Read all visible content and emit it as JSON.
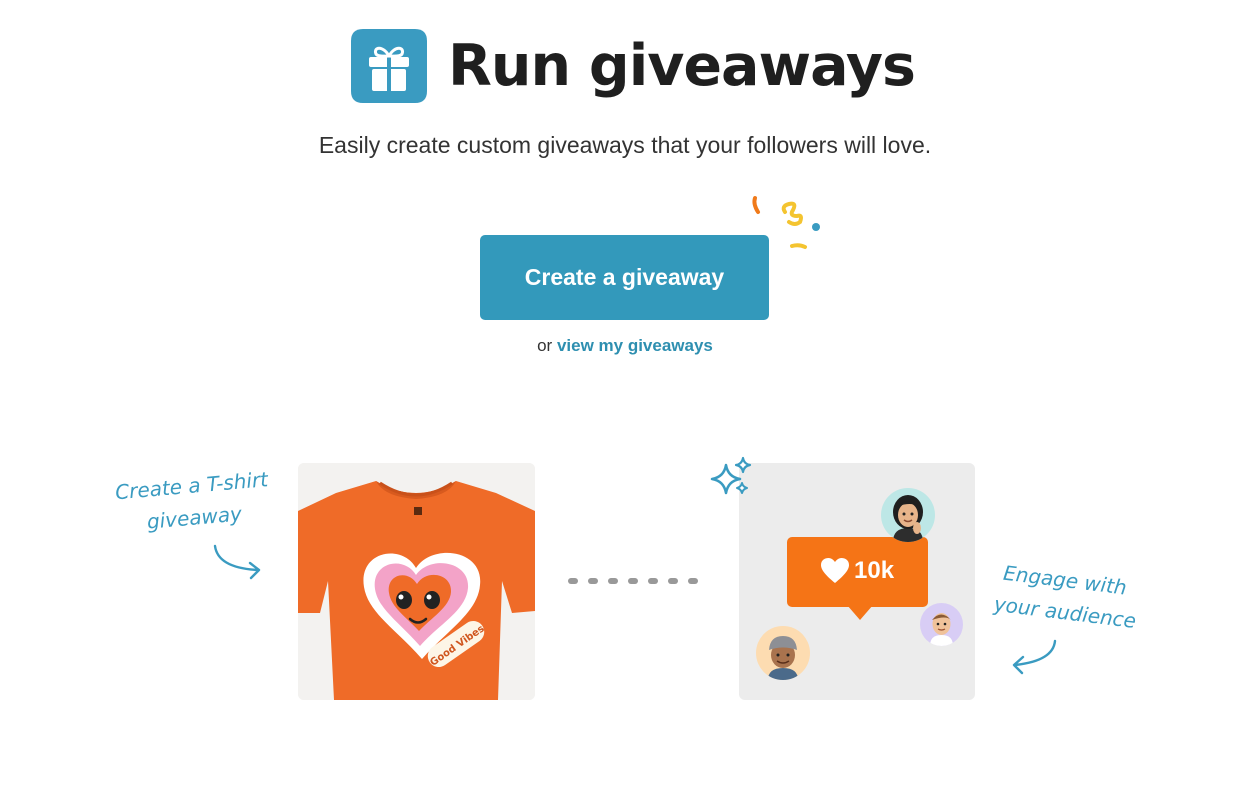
{
  "header": {
    "title": "Run giveaways",
    "icon": "gift-icon",
    "badge_color": "#3a9bc1"
  },
  "subtitle": "Easily create custom giveaways that your followers will love.",
  "cta": {
    "label": "Create a giveaway",
    "color": "#3399bb"
  },
  "alt_link": {
    "prefix": "or",
    "label": "view my giveaways"
  },
  "illustration": {
    "left_note": [
      "Create a T-shirt",
      "giveaway"
    ],
    "right_note": [
      "Engage with",
      "your audience"
    ],
    "tshirt_print_text": "Good Vibes",
    "likes": "10k",
    "icons": [
      "tshirt-image",
      "sparkle-icon",
      "heart-icon",
      "curved-arrow-icon",
      "avatar"
    ]
  }
}
